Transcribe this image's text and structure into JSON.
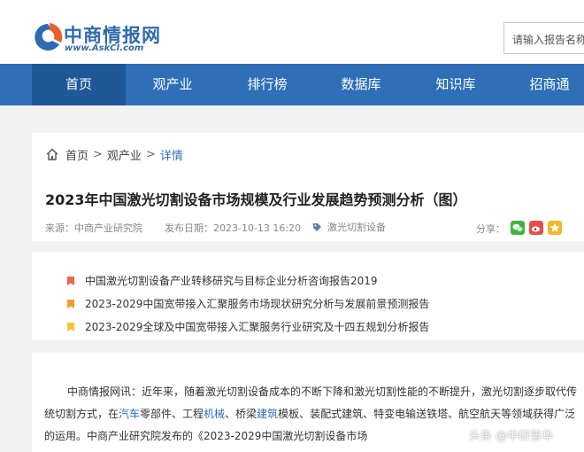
{
  "header": {
    "logo_text": "中商情报网",
    "logo_url": "www.AskCI.com",
    "search_placeholder": "请输入报告名称"
  },
  "nav": {
    "items": [
      {
        "label": "首页",
        "active": true
      },
      {
        "label": "观产业"
      },
      {
        "label": "排行榜"
      },
      {
        "label": "数据库"
      },
      {
        "label": "知识库"
      },
      {
        "label": "招商通"
      }
    ]
  },
  "breadcrumb": {
    "home": "首页",
    "sep1": ">",
    "section": "观产业",
    "sep2": ">",
    "current": "详情"
  },
  "article": {
    "title": "2023年中国激光切割设备市场规模及行业发展趋势预测分析（图）",
    "source": "来源：中商产业研究院",
    "date": "发布日期：2023-10-13 16:20",
    "tag": "激光切割设备",
    "share_label": "分享："
  },
  "related": [
    {
      "text": "中国激光切割设备产业转移研究与目标企业分析咨询报告2019",
      "color": "#e8664f"
    },
    {
      "text": "2023-2029中国宽带接入汇聚服务市场现状研究分析与发展前景预测报告",
      "color": "#f39a2c"
    },
    {
      "text": "2023-2029全球及中国宽带接入汇聚服务行业研究及十四五规划分析报告",
      "color": "#f5c53a"
    }
  ],
  "body": {
    "p1_a": "中商情报网讯：近年来，随着激光切割设备成本的不断下降和激光切割性能的不断提升，激光切割逐步取代传统切割方式，在",
    "link1": "汽车",
    "p1_b": "零部件、工程",
    "link2": "机械",
    "p1_c": "、桥梁",
    "link3": "建筑",
    "p1_d": "模板、装配式建筑、特变电输送铁塔、航空航天等领域获得广泛的运用。中商产业研究院发布的《2023-2029中国激光切割设备市场"
  },
  "watermark": "头条 @中研普华"
}
